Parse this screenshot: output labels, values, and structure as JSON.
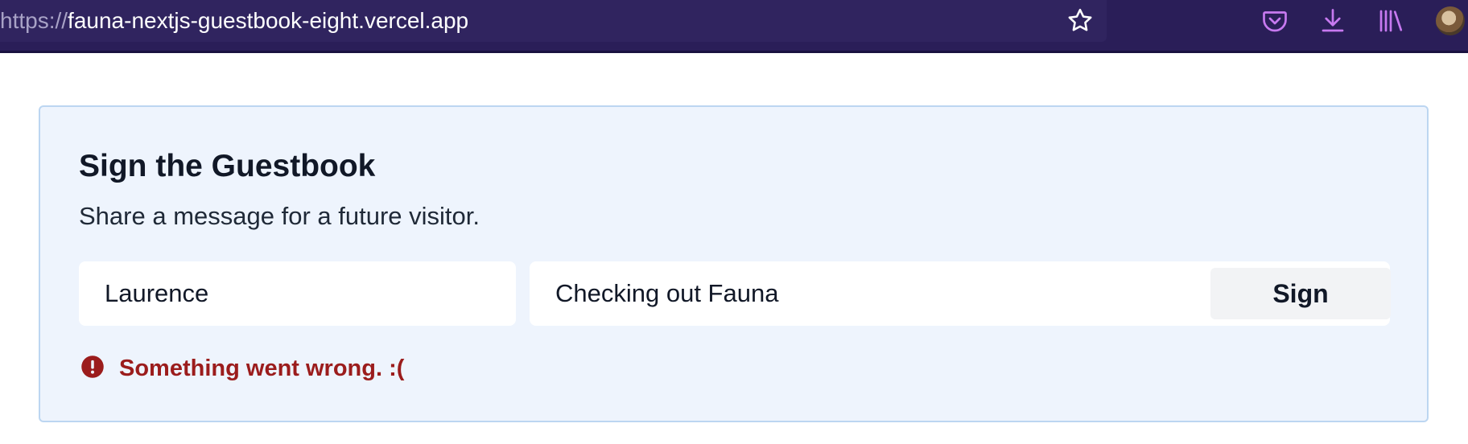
{
  "browser": {
    "url_scheme": "https://",
    "url_host": "fauna-nextjs-guestbook-eight.vercel.app",
    "bookmark_icon": "star-icon",
    "toolbar_icons": [
      "pocket-icon",
      "download-icon",
      "library-icon",
      "avatar"
    ],
    "colors": {
      "toolbar": "#2a1e58",
      "icon_accent": "#c779f0"
    }
  },
  "guestbook": {
    "title": "Sign the Guestbook",
    "subtitle": "Share a message for a future visitor.",
    "name_value": "Laurence",
    "message_value": "Checking out Fauna",
    "sign_label": "Sign",
    "error_text": "Something went wrong. :(",
    "error_icon": "exclamation-circle-icon",
    "colors": {
      "card_background": "#eef4fd",
      "card_border": "#bcd6f1",
      "error": "#9b1c1c"
    }
  }
}
